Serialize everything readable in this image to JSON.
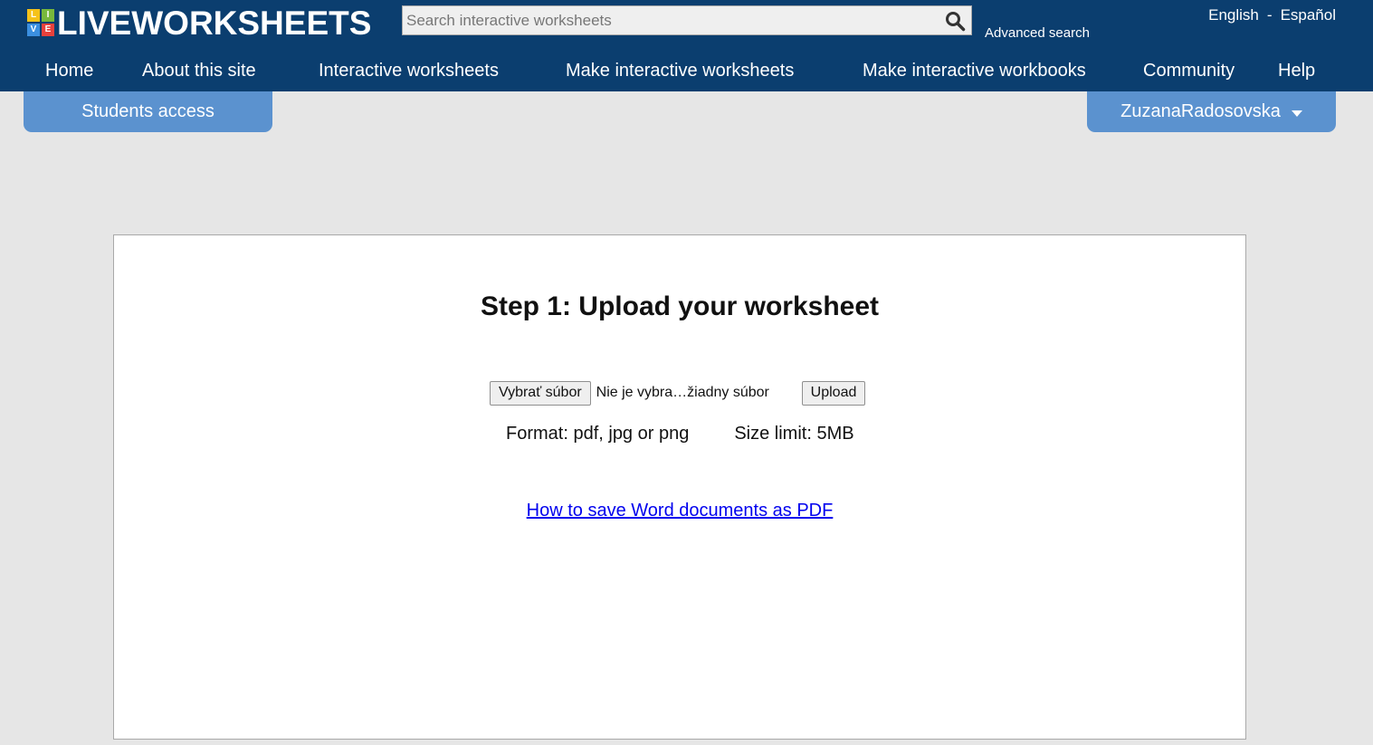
{
  "brand": {
    "tiles": [
      {
        "letter": "L",
        "color": "#f5c21a"
      },
      {
        "letter": "I",
        "color": "#78b83c"
      },
      {
        "letter": "V",
        "color": "#3b8fe0"
      },
      {
        "letter": "E",
        "color": "#e8413c"
      }
    ],
    "name": "LIVEWORKSHEETS"
  },
  "search": {
    "placeholder": "Search interactive worksheets",
    "advanced_label": "Advanced search"
  },
  "languages": {
    "first": "English",
    "separator": "-",
    "second": "Español"
  },
  "nav": [
    "Home",
    "About this site",
    "Interactive worksheets",
    "Make interactive worksheets",
    "Make interactive workbooks",
    "Community",
    "Help"
  ],
  "tabs": {
    "students": "Students access",
    "user": "ZuzanaRadosovska"
  },
  "upload": {
    "title": "Step 1: Upload your worksheet",
    "choose_file_label": "Vybrať súbor",
    "file_status": "Nie je vybra…žiadny súbor",
    "upload_label": "Upload",
    "format_text": "Format: pdf, jpg or png",
    "size_text": "Size limit: 5MB",
    "help_link": "How to save Word documents as PDF"
  },
  "colors": {
    "header_bg": "#0b3e6f",
    "tab_bg": "#5b92cf",
    "page_bg": "#e6e6e6",
    "link": "#0000ee"
  }
}
